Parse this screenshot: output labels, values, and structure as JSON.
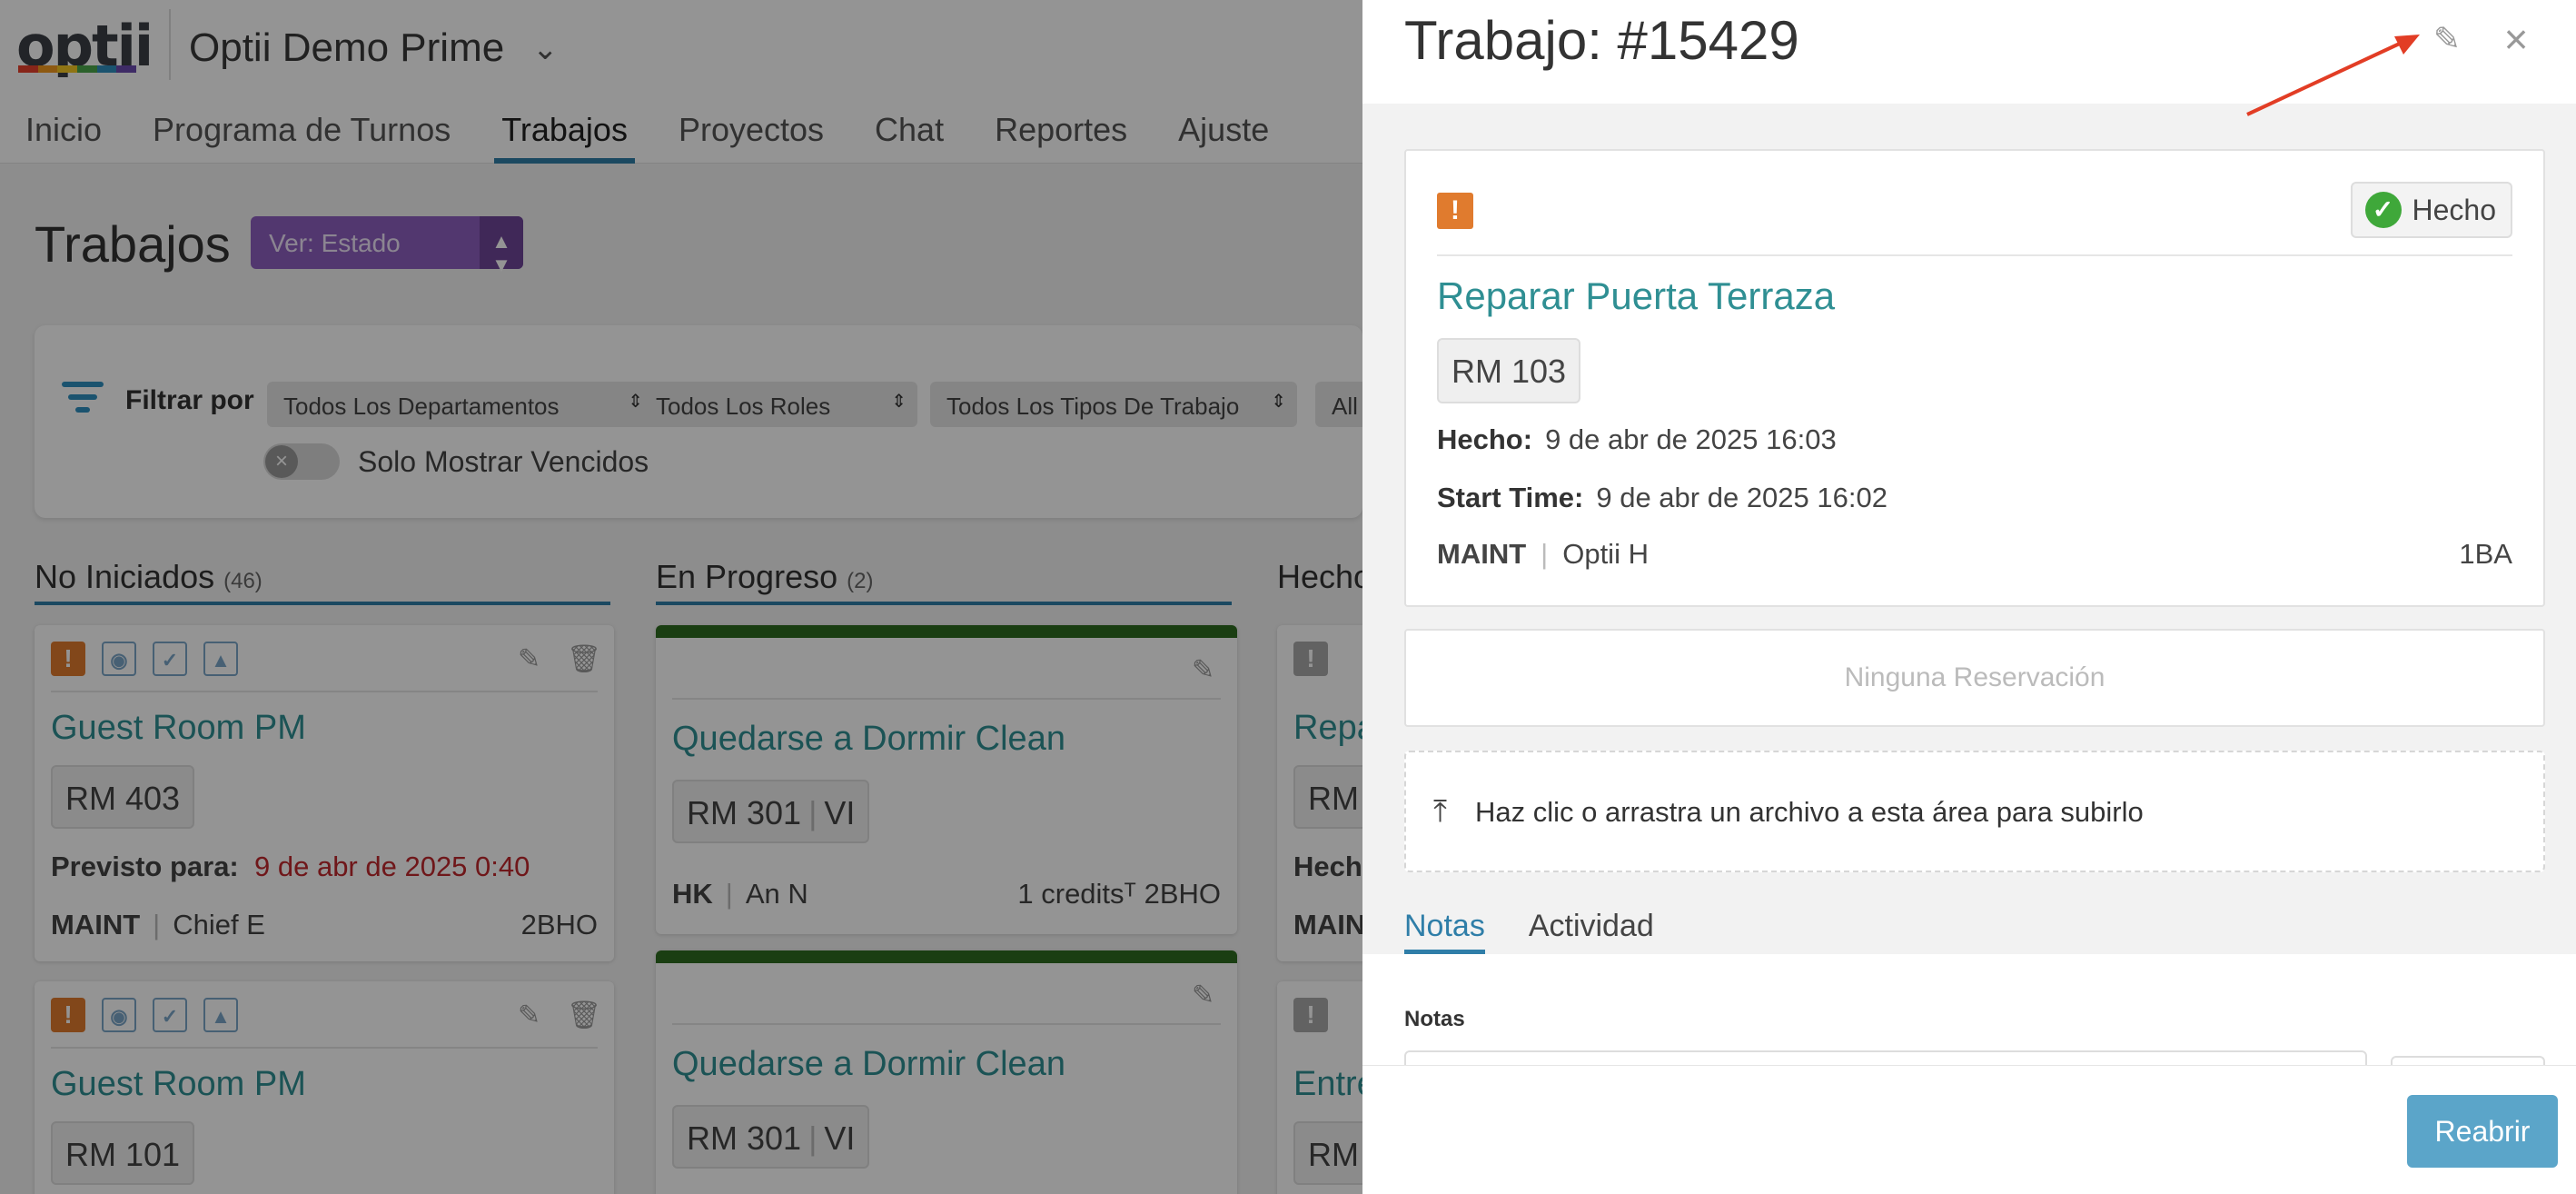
{
  "app": {
    "logo": "optii",
    "property": "Optii Demo Prime",
    "brand_colors": [
      "#e8412c",
      "#f39a1e",
      "#f6c824",
      "#4aa84a",
      "#2f8fc0",
      "#6b4bb0"
    ]
  },
  "nav": {
    "items": [
      {
        "label": "Inicio"
      },
      {
        "label": "Programa de Turnos"
      },
      {
        "label": "Trabajos"
      },
      {
        "label": "Proyectos"
      },
      {
        "label": "Chat"
      },
      {
        "label": "Reportes"
      },
      {
        "label": "Ajuste"
      }
    ],
    "active": "Trabajos"
  },
  "page": {
    "title": "Trabajos",
    "view_select": "Ver: Estado"
  },
  "filters": {
    "label": "Filtrar por",
    "departments": "Todos Los Departamentos",
    "roles": "Todos Los Roles",
    "job_types": "Todos Los Tipos De Trabajo",
    "more": "All",
    "overdue_label": "Solo Mostrar Vencidos"
  },
  "columns": [
    {
      "title": "No Iniciados",
      "count": "(46)"
    },
    {
      "title": "En Progreso",
      "count": "(2)"
    },
    {
      "title": "Hecho",
      "count": ""
    }
  ],
  "cards": {
    "c1": {
      "title": "Guest Room PM",
      "room": "RM 403",
      "due_label": "Previsto para:",
      "due_value": "9 de abr de 2025 0:40",
      "dept": "MAINT",
      "assignee": "Chief E",
      "code": "2BHO"
    },
    "c2": {
      "title": "Guest Room PM",
      "room": "RM 101"
    },
    "p1": {
      "title": "Quedarse a Dormir Clean",
      "room": "RM 301",
      "room_code": "VI",
      "dept": "HK",
      "assignee": "An N",
      "right": "1 creditsᵀ 2BHO"
    },
    "p2": {
      "title": "Quedarse a Dormir Clean",
      "room": "RM 301",
      "room_code": "VI"
    },
    "h1": {
      "title": "Repa",
      "room": "RM",
      "line": "Hech",
      "dept": "MAIN"
    },
    "h2": {
      "title": "Entre",
      "room": "RM"
    }
  },
  "panel": {
    "title": "Trabajo: #15429",
    "status": "Hecho",
    "job_title": "Reparar Puerta Terraza",
    "room": "RM 103",
    "done_label": "Hecho:",
    "done_value": "9 de abr de 2025 16:03",
    "start_label": "Start Time:",
    "start_value": "9 de abr de 2025 16:02",
    "dept": "MAINT",
    "assignee": "Optii H",
    "code": "1BA",
    "reservation": "Ninguna Reservación",
    "upload": "Haz clic o arrastra un archivo a esta área para subirlo",
    "tabs": [
      {
        "label": "Notas"
      },
      {
        "label": "Actividad"
      }
    ],
    "notes_label": "Notas",
    "reopen": "Reabrir"
  },
  "annotation": {
    "arrow_color": "#e23d25"
  }
}
